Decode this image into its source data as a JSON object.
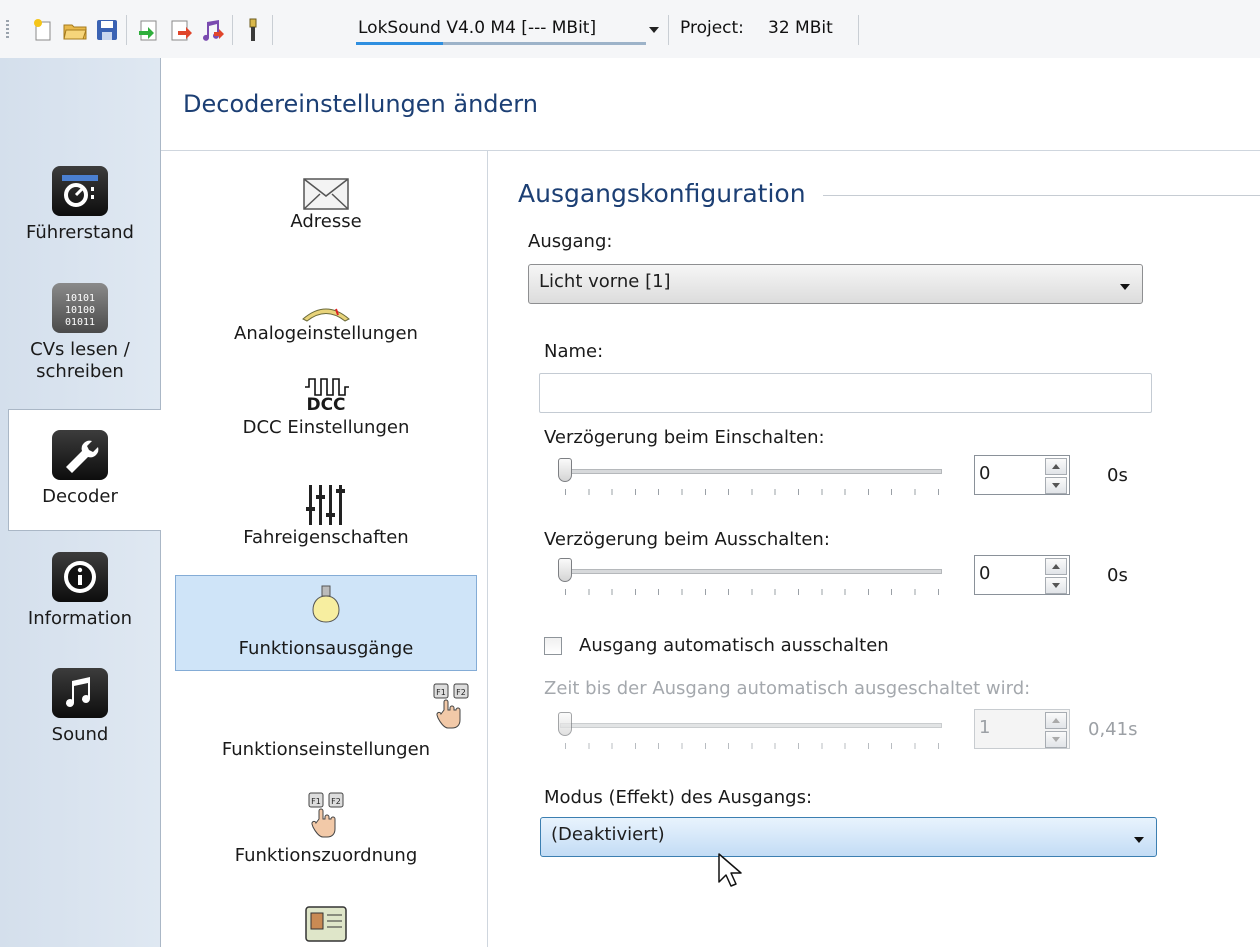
{
  "toolbar": {
    "decoder_combo": "LokSound V4.0 M4 [--- MBit]",
    "project_label": "Project:",
    "project_value": "32 MBit",
    "icons": [
      "new-file-icon",
      "open-folder-icon",
      "save-icon",
      "import-icon",
      "export-icon",
      "sound-export-icon",
      "usb-plug-icon"
    ]
  },
  "leftnav": {
    "items": [
      {
        "label": "Führerstand",
        "icon": "cab-icon"
      },
      {
        "label": "CVs lesen / schreiben",
        "icon": "binary-icon"
      },
      {
        "label": "Decoder",
        "icon": "wrench-icon"
      },
      {
        "label": "Information",
        "icon": "info-icon"
      },
      {
        "label": "Sound",
        "icon": "music-note-icon"
      }
    ],
    "active": "Decoder"
  },
  "main": {
    "title": "Decodereinstellungen ändern"
  },
  "categories": [
    {
      "label": "Adresse",
      "icon": "envelope-icon"
    },
    {
      "label": "Analogeinstellungen",
      "icon": "gauge-icon"
    },
    {
      "label": "DCC Einstellungen",
      "icon": "dcc-icon",
      "icon_text": "DCC"
    },
    {
      "label": "Fahreigenschaften",
      "icon": "sliders-icon"
    },
    {
      "label": "Funktionsausgänge",
      "icon": "lightbulb-icon",
      "selected": true
    },
    {
      "label": "Funktionseinstellungen",
      "icon": "function-keys-icon",
      "key_labels": [
        "F1",
        "F2"
      ]
    },
    {
      "label": "Funktionszuordnung",
      "icon": "function-mapping-icon",
      "key_labels": [
        "F1",
        "F2"
      ]
    },
    {
      "label": "",
      "icon": "id-card-icon"
    }
  ],
  "pane": {
    "group_title": "Ausgangskonfiguration",
    "ausgang_label": "Ausgang:",
    "ausgang_value": "Licht vorne [1]",
    "name_label": "Name:",
    "name_value": "",
    "delay_on_label": "Verzögerung beim Einschalten:",
    "delay_on_value": "0",
    "delay_on_unit": "0s",
    "delay_off_label": "Verzögerung beim Ausschalten:",
    "delay_off_value": "0",
    "delay_off_unit": "0s",
    "auto_off_label": "Ausgang automatisch ausschalten",
    "auto_off_checked": false,
    "auto_time_label": "Zeit bis der Ausgang automatisch ausgeschaltet wird:",
    "auto_time_value": "1",
    "auto_time_unit": "0,41s",
    "mode_label": "Modus (Effekt) des Ausgangs:",
    "mode_value": "(Deaktiviert)"
  }
}
